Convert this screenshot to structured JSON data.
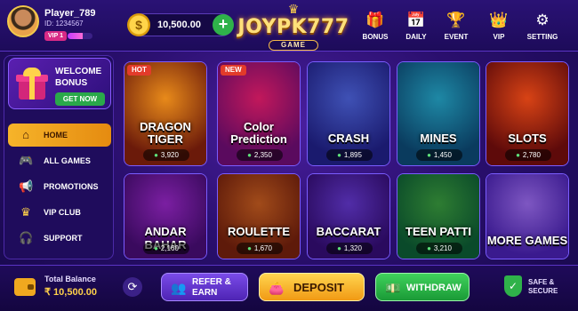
{
  "player": {
    "name": "Player_789",
    "id": "ID: 1234567",
    "vip": "VIP 1",
    "vip_progress": 0.6
  },
  "balance": {
    "amount": "10,500.00",
    "coin_symbol": "$",
    "add_symbol": "+"
  },
  "logo": {
    "title": "JOYPK777",
    "subtitle": "GAME",
    "crown": "♛"
  },
  "top_nav": [
    {
      "label": "BONUS",
      "icon": "gift-icon",
      "glyph": "🎁"
    },
    {
      "label": "DAILY",
      "icon": "calendar-icon",
      "glyph": "📅"
    },
    {
      "label": "EVENT",
      "icon": "trophy-icon",
      "glyph": "🏆"
    },
    {
      "label": "VIP",
      "icon": "vip-crown-icon",
      "glyph": "👑"
    },
    {
      "label": "SETTING",
      "icon": "gear-icon",
      "glyph": "⚙"
    }
  ],
  "welcome": {
    "title_line1": "WELCOME",
    "title_line2": "BONUS",
    "button": "GET NOW"
  },
  "sidebar": [
    {
      "label": "HOME",
      "icon": "home-icon",
      "glyph": "⌂",
      "active": true
    },
    {
      "label": "ALL GAMES",
      "icon": "gamepad-icon",
      "glyph": "🎮",
      "active": false
    },
    {
      "label": "PROMOTIONS",
      "icon": "megaphone-icon",
      "glyph": "📢",
      "active": false
    },
    {
      "label": "VIP CLUB",
      "icon": "crown-icon",
      "glyph": "♛",
      "active": false
    },
    {
      "label": "SUPPORT",
      "icon": "headset-icon",
      "glyph": "🎧",
      "active": false
    }
  ],
  "games": [
    {
      "title": "DRAGON TIGER",
      "players": "3,920",
      "tag": "HOT",
      "colors": [
        "#6b1a0a",
        "#e88a1a"
      ]
    },
    {
      "title": "Color Prediction",
      "players": "2,350",
      "tag": "NEW",
      "colors": [
        "#5a0a5e",
        "#c2185b"
      ]
    },
    {
      "title": "CRASH",
      "players": "1,895",
      "tag": "",
      "colors": [
        "#1a1a6e",
        "#3f51b5"
      ]
    },
    {
      "title": "MINES",
      "players": "1,450",
      "tag": "",
      "colors": [
        "#0a3b5e",
        "#1e88a5"
      ]
    },
    {
      "title": "SLOTS",
      "players": "2,780",
      "tag": "",
      "colors": [
        "#5e0a0a",
        "#d84315"
      ]
    },
    {
      "title": "ANDAR BAHAR",
      "players": "2,160",
      "tag": "",
      "colors": [
        "#3a0a5e",
        "#7b1fa2"
      ]
    },
    {
      "title": "ROULETTE",
      "players": "1,670",
      "tag": "",
      "colors": [
        "#5e1a0a",
        "#a14b1a"
      ]
    },
    {
      "title": "BACCARAT",
      "players": "1,320",
      "tag": "",
      "colors": [
        "#2a0a5e",
        "#512da8"
      ]
    },
    {
      "title": "TEEN PATTI",
      "players": "3,210",
      "tag": "",
      "colors": [
        "#0a4a2a",
        "#2e7d32"
      ]
    },
    {
      "title": "MORE GAMES",
      "players": "",
      "tag": "",
      "colors": [
        "#3a1a8e",
        "#7e57c2"
      ]
    }
  ],
  "bottom": {
    "total_balance_label": "Total Balance",
    "total_balance_value": "₹ 10,500.00",
    "refer_line1": "REFER &",
    "refer_line2": "EARN",
    "deposit": "DEPOSIT",
    "withdraw": "WITHDRAW",
    "safe_line1": "SAFE &",
    "safe_line2": "SECURE"
  }
}
